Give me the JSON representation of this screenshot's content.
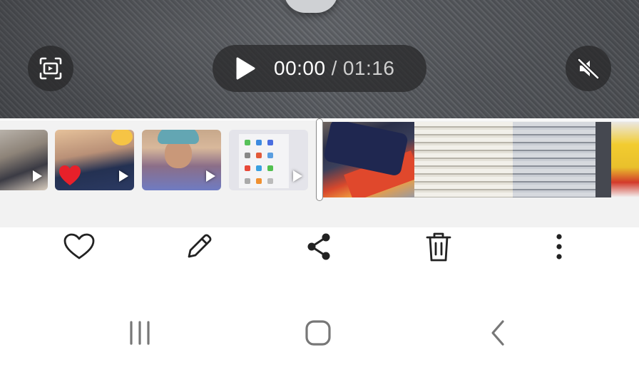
{
  "player": {
    "current_time": "00:00",
    "separator": "/",
    "duration": "01:16"
  },
  "icons": {
    "capture": "screen-capture-icon",
    "play": "play-icon",
    "mute": "volume-muted-icon",
    "favorite": "heart-icon",
    "edit": "pencil-icon",
    "share": "share-icon",
    "delete": "trash-icon",
    "more": "more-vertical-icon",
    "recent_apps": "recent-apps-icon",
    "home": "home-icon",
    "back": "back-icon"
  },
  "thumbnails": [
    {
      "type": "video"
    },
    {
      "type": "video"
    },
    {
      "type": "video"
    },
    {
      "type": "video"
    }
  ],
  "colors": {
    "overlay": "#28282a",
    "white": "#ffffff",
    "icon": "#222222",
    "nav_icon": "#777777"
  }
}
